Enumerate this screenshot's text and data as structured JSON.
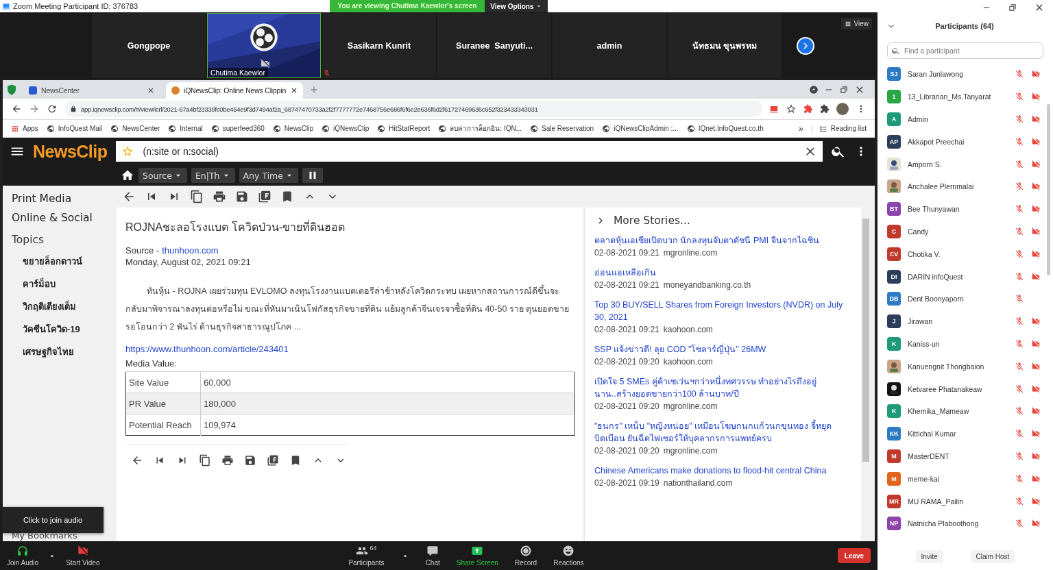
{
  "title_bar": {
    "title": "Zoom Meeting Participant ID: 376783",
    "banner": "You are viewing Chutima Kaewlor's screen",
    "view_options": "View Options"
  },
  "video_strip": {
    "view_button": "View",
    "tiles": [
      {
        "name": "Gongpope",
        "kind": "name",
        "mic_muted": false
      },
      {
        "name": "Chutima Kaewlor",
        "kind": "video",
        "mic_muted": true
      },
      {
        "name": "Sasikarn Kunrit",
        "kind": "name",
        "mic_muted": false
      },
      {
        "name": "Suranee  Sanyuti...",
        "kind": "name",
        "mic_muted": false
      },
      {
        "name": "admin",
        "kind": "name",
        "mic_muted": false
      },
      {
        "name": "นัทธมน ขุนพรหม",
        "kind": "name",
        "mic_muted": false
      }
    ]
  },
  "browser": {
    "tabs": [
      {
        "label": "NewsCenter",
        "selected": false
      },
      {
        "label": "iQNewsClip: Online News Clippin",
        "selected": true
      }
    ],
    "url": "app.iqnewsclip.com/#/view/icrl/2021-67a4bf23339fc0be454e9f3d7494af2a_68747470733a2f2f7777772e7468756e686f6f6e2e636f6d2f61727469636c652f323433343031",
    "bookmarks": [
      {
        "label": "Apps",
        "kind": "apps"
      },
      {
        "label": "InfoQuest Mail",
        "kind": "site"
      },
      {
        "label": "NewsCenter",
        "kind": "site"
      },
      {
        "label": "Internal",
        "kind": "site"
      },
      {
        "label": "superfeed360",
        "kind": "site"
      },
      {
        "label": "NewsClip",
        "kind": "site"
      },
      {
        "label": "iQNewsClip",
        "kind": "site"
      },
      {
        "label": "HitStatReport",
        "kind": "site"
      },
      {
        "label": "ลบค่าการล็อกอิน: IQN...",
        "kind": "site"
      },
      {
        "label": "Sale Reservation",
        "kind": "site"
      },
      {
        "label": "iQNewsClipAdmin :...",
        "kind": "site"
      },
      {
        "label": "IQnet.InfoQuest.co.th",
        "kind": "site"
      }
    ],
    "bookmarks_overflow": "»",
    "reading_list": "Reading list"
  },
  "app": {
    "logo": "NewsClip",
    "search": {
      "value": "(n:site or n:social)"
    },
    "filters": [
      "Source",
      "En|Th",
      "Any Time"
    ]
  },
  "sidebar": {
    "sections": [
      "Print Media",
      "Online & Social"
    ],
    "topics_heading": "Topics",
    "topics": [
      "ขยายล็อกดาวน์",
      "คาร์ม็อบ",
      "วิกฤติเตียงเต็ม",
      "วัคซีนโควิด-19",
      "เศรษฐกิจไทย"
    ],
    "bookmarks": "My Bookmarks"
  },
  "article": {
    "title": "ROJNAชะลอโรงแบต โควิดป่วน-ขายที่ดินฮอต",
    "source_label": "Source -",
    "source": "thunhoon.com",
    "date": "Monday, August 02, 2021 09:21",
    "body": "ทันหุ้น - ROJNA เผยร่วมทุน EVLOMO ลงทุนโรงงานแบตเตอรีล่าช้าหลังโควิดกระทบ เผยหากสถานการณ์ดีขึ้นจะกลับมาพิจารณาลงทุนต่อหรือไม่ ขณะที่หันมาเน้นโฟกัสธุรกิจขายที่ดิน แย้มลูกค้าจีนเจรจาซื้อที่ดิน 40-50 ราย ตุนยอดขายรอโอนกว่า 2 พันไร่ ด้านธุรกิจสาธารณูปโภค ...",
    "link": "https://www.thunhoon.com/article/243401",
    "media_value_label": "Media Value:",
    "media_values": [
      {
        "label": "Site Value",
        "value": "60,000"
      },
      {
        "label": "PR Value",
        "value": "180,000"
      },
      {
        "label": "Potential Reach",
        "value": "109,974"
      }
    ]
  },
  "more_stories": {
    "heading": "More Stories...",
    "stories": [
      {
        "title": "ตลาดหุ้นเอเชียเปิดบวก นักลงทุนจับตาดัชนี PMI จีนจากไฉซิน",
        "time": "02-08-2021 09:21",
        "source": "mgronline.com"
      },
      {
        "title": "อ่อนแอเหลือเกิน",
        "time": "02-08-2021 09:21",
        "source": "moneyandbanking.co.th"
      },
      {
        "title": "Top 30 BUY/SELL Shares from Foreign Investors (NVDR) on July 30, 2021",
        "time": "02-08-2021 09:21",
        "source": "kaohoon.com"
      },
      {
        "title": "SSP แจ้งข่าวดี! ลุย COD \"โซลาร์ญี่ปุ่น\" 26MW",
        "time": "02-08-2021 09:20",
        "source": "kaohoon.com"
      },
      {
        "title": "เปิดใจ 5 SMEs คู่ค้าเซเว่นฯกว่าหนึ่งทศวรรษ ทำอย่างไรถึงอยู่นาน..สร้างยอดขายกว่า100 ล้านบาท/ปี",
        "time": "02-08-2021 09:20",
        "source": "mgronline.com"
      },
      {
        "title": "\"ธนกร\" เหน็บ \"หญิงหน่อย\" เหมือนโฆษกนกแก้วนกขุนทอง จี้หยุดบิดเบือน ยันฉีดไฟเซอร์ให้บุคลากรการแพทย์ครบ",
        "time": "02-08-2021 09:20",
        "source": "mgronline.com"
      },
      {
        "title": "Chinese Americans make donations to flood-hit central China",
        "time": "02-08-2021 09:19",
        "source": "nationthailand.com"
      }
    ]
  },
  "join_audio_tooltip": "Click to join audio",
  "toolbar": {
    "join_audio": "Join Audio",
    "start_video": "Start Video",
    "participants": "Participants",
    "participant_count": "64",
    "chat": "Chat",
    "share_screen": "Share Screen",
    "record": "Record",
    "reactions": "Reactions",
    "leave": "Leave"
  },
  "participants_panel": {
    "title": "Participants (64)",
    "search": {
      "placeholder": "Find a participant"
    },
    "participants": [
      {
        "name": "Saran Junlawong",
        "kind": "initials",
        "initials": "SJ",
        "color": "#2d7bc4",
        "video_muted": true
      },
      {
        "name": "13_Librarian_Ms.Tanyarat",
        "kind": "initials",
        "initials": "1",
        "color": "#27a745",
        "video_muted": true
      },
      {
        "name": "Admin",
        "kind": "initials",
        "initials": "A",
        "color": "#1d9a7a",
        "video_muted": true
      },
      {
        "name": "Akkapot Preechai",
        "kind": "initials",
        "initials": "AP",
        "color": "#2c3e5a",
        "video_muted": true
      },
      {
        "name": "Amporn S.",
        "kind": "picture",
        "video_muted": true
      },
      {
        "name": "Anchalee Plernmalai",
        "kind": "picture",
        "video_muted": true
      },
      {
        "name": "Bee Thunyawan",
        "kind": "initials",
        "initials": "BT",
        "color": "#8e44ad",
        "video_muted": true
      },
      {
        "name": "Candy",
        "kind": "initials",
        "initials": "C",
        "color": "#c0392b",
        "video_muted": true
      },
      {
        "name": "Chotika V.",
        "kind": "initials",
        "initials": "CV",
        "color": "#c0392b",
        "video_muted": true
      },
      {
        "name": "DARIN infoQuest",
        "kind": "initials",
        "initials": "DI",
        "color": "#2c3e5a",
        "video_muted": true
      },
      {
        "name": "Dent Boonyaporn",
        "kind": "initials",
        "initials": "DB",
        "color": "#2d7bc4",
        "video_muted": false
      },
      {
        "name": "Jirawan",
        "kind": "initials",
        "initials": "J",
        "color": "#2c3e5a",
        "video_muted": true
      },
      {
        "name": "Kaniss-un",
        "kind": "initials",
        "initials": "K",
        "color": "#1d9a7a",
        "video_muted": true
      },
      {
        "name": "Kanuengnit Thongbaion",
        "kind": "picture",
        "video_muted": true
      },
      {
        "name": "Ketvaree Phatanakeaw",
        "kind": "picture",
        "video_muted": true
      },
      {
        "name": "Khemika_Mameaw",
        "kind": "initials",
        "initials": "K",
        "color": "#1d9a7a",
        "video_muted": true
      },
      {
        "name": "Kittichai Kumar",
        "kind": "initials",
        "initials": "KK",
        "color": "#2d7bc4",
        "video_muted": true
      },
      {
        "name": "MasterDENT",
        "kind": "initials",
        "initials": "M",
        "color": "#c0392b",
        "video_muted": true
      },
      {
        "name": "meme-kai",
        "kind": "initials",
        "initials": "M",
        "color": "#e0641c",
        "video_muted": true
      },
      {
        "name": "MU RAMA_Pailin",
        "kind": "initials",
        "initials": "MR",
        "color": "#c0392b",
        "video_muted": true
      },
      {
        "name": "Natnicha Plaboothong",
        "kind": "initials",
        "initials": "NP",
        "color": "#8e44ad",
        "video_muted": true
      }
    ],
    "buttons": [
      "Invite",
      "Claim Host"
    ]
  }
}
